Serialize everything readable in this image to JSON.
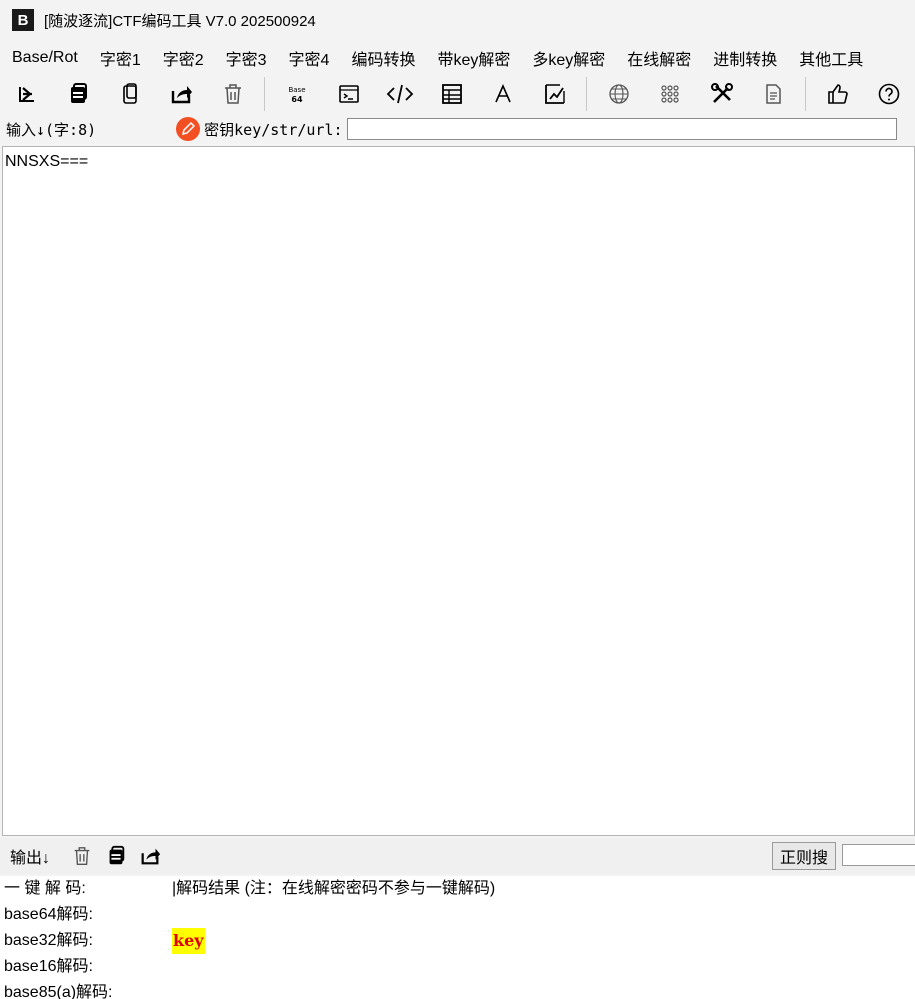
{
  "window": {
    "title": "[随波逐流]CTF编码工具 V7.0  202500924",
    "icon_letter": "B"
  },
  "menu": [
    "Base/Rot",
    "字密1",
    "字密2",
    "字密3",
    "字密4",
    "编码转换",
    "带key解密",
    "多key解密",
    "在线解密",
    "进制转换",
    "其他工具"
  ],
  "toolbar_icons": [
    "import-icon",
    "copy-icon",
    "paste-icon",
    "share-icon",
    "trash-icon",
    "base64-icon",
    "terminal-icon",
    "code-icon",
    "table-icon",
    "font-icon",
    "chart-icon",
    "globe-icon",
    "grid-icon",
    "tools-icon",
    "document-icon",
    "thumbs-up-icon",
    "help-icon"
  ],
  "input": {
    "label": "输入↓(字:8)",
    "key_label": "密钥key/str/url:",
    "key_value": "",
    "content": "NNSXS==="
  },
  "output": {
    "label": "输出↓",
    "regex_button": "正则搜",
    "regex_value": "",
    "rows": [
      {
        "label": "一 键 解 码:",
        "value": "|解码结果 (注：在线解密密码不参与一键解码)"
      },
      {
        "label": "base64解码:",
        "value": ""
      },
      {
        "label": "base32解码:",
        "value": "key"
      },
      {
        "label": "base16解码:",
        "value": ""
      },
      {
        "label": "base85(a)解码:",
        "value": ""
      }
    ]
  },
  "colors": {
    "highlight_bg": "#ffff00",
    "highlight_fg": "#e00000",
    "key_icon": "#f25022"
  }
}
